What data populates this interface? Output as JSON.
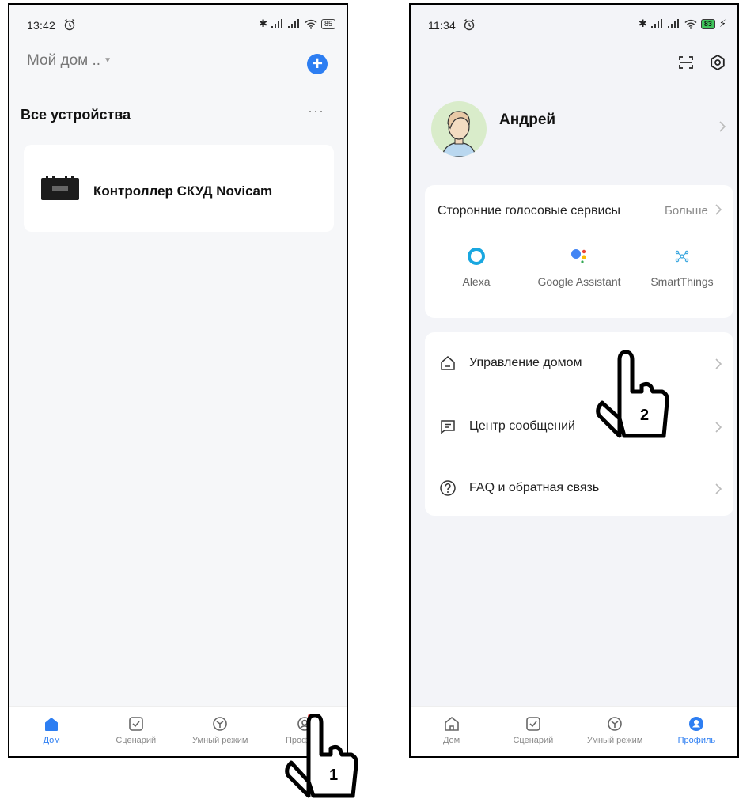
{
  "screen1": {
    "status": {
      "time": "13:42",
      "battery": "85"
    },
    "home_title": "Мой дом ..",
    "section_title": "Все устройства",
    "more_label": "···",
    "device": {
      "name": "Контроллер СКУД Novicam"
    },
    "tabs": [
      {
        "label": "Дом",
        "active": true
      },
      {
        "label": "Сценарий"
      },
      {
        "label": "Умный режим"
      },
      {
        "label": "Профиль"
      }
    ],
    "pointer_label": "1"
  },
  "screen2": {
    "status": {
      "time": "11:34",
      "battery": "83"
    },
    "profile": {
      "name": "Андрей"
    },
    "voice_services": {
      "title": "Сторонние голосовые сервисы",
      "more_label": "Больше",
      "services": [
        {
          "label": "Alexa"
        },
        {
          "label": "Google Assistant"
        },
        {
          "label": "SmartThings"
        }
      ]
    },
    "menu": [
      {
        "label": "Управление домом",
        "icon": "house-icon"
      },
      {
        "label": "Центр сообщений",
        "icon": "message-icon"
      },
      {
        "label": "FAQ и обратная связь",
        "icon": "help-icon"
      }
    ],
    "tabs": [
      {
        "label": "Дом"
      },
      {
        "label": "Сценарий"
      },
      {
        "label": "Умный режим"
      },
      {
        "label": "Профиль",
        "active": true
      }
    ],
    "pointer_label": "2"
  },
  "colors": {
    "accent": "#2d7ef2",
    "badge": "#ee3b3b",
    "battery_charging": "#3fc55b"
  }
}
